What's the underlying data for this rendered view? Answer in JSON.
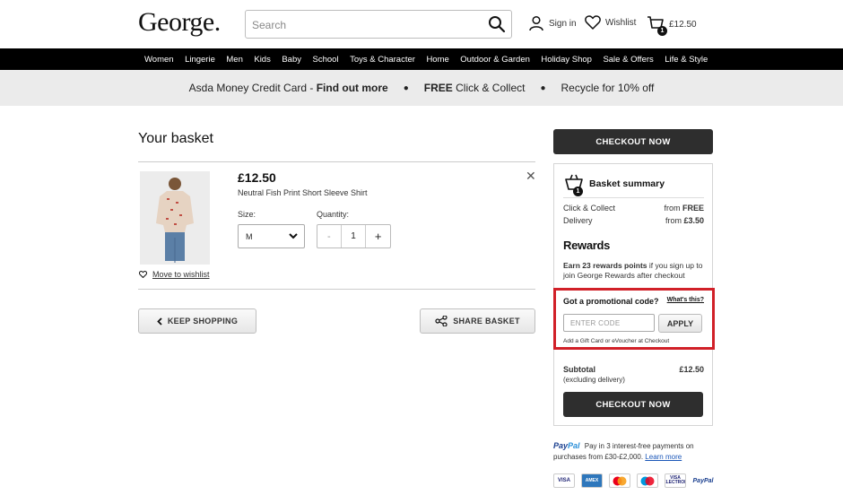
{
  "header": {
    "logo": "George.",
    "search_placeholder": "Search",
    "sign_in": "Sign in",
    "wishlist": "Wishlist",
    "bag_total": "£12.50",
    "bag_count": "1"
  },
  "nav": [
    "Women",
    "Lingerie",
    "Men",
    "Kids",
    "Baby",
    "School",
    "Toys & Character",
    "Home",
    "Outdoor & Garden",
    "Holiday Shop",
    "Sale & Offers",
    "Life & Style"
  ],
  "promo": {
    "item1_text": "Asda Money Credit Card - ",
    "item1_bold": "Find out more",
    "item2_bold": "FREE",
    "item2_text": " Click & Collect",
    "item3_text": "Recycle for 10% off"
  },
  "basket": {
    "title": "Your basket",
    "item": {
      "price": "£12.50",
      "name": "Neutral Fish Print Short Sleeve Shirt",
      "size_label": "Size:",
      "size_value": "M",
      "quantity_label": "Quantity:",
      "quantity": "1",
      "move_to_wishlist": "Move to wishlist"
    },
    "keep_shopping": "KEEP SHOPPING",
    "share_basket": "SHARE BASKET"
  },
  "summary": {
    "checkout_label": "CHECKOUT NOW",
    "title": "Basket summary",
    "count": "1",
    "click_collect_label": "Click & Collect",
    "click_collect_prefix": "from ",
    "click_collect_value": "FREE",
    "delivery_label": "Delivery",
    "delivery_prefix": "from ",
    "delivery_value": "£3.50",
    "rewards_title": "Rewards",
    "rewards_bold": "Earn 23 rewards points",
    "rewards_text": " if you sign up to join George Rewards after checkout",
    "promo_question": "Got a promotional code?",
    "whats_this": "What's this?",
    "code_placeholder": "ENTER CODE",
    "apply": "APPLY",
    "gift_note": "Add a Gift Card or eVoucher at Checkout",
    "subtotal_label": "Subtotal",
    "subtotal_note": "(excluding delivery)",
    "subtotal_value": "£12.50"
  },
  "paypal": {
    "brand_pay": "Pay",
    "brand_pal": "Pal",
    "text": "Pay in 3 interest-free payments on purchases from £30-£2,000.",
    "link": "Learn more"
  },
  "cards": [
    "VISA",
    "AMEX",
    "mastercard",
    "maestro",
    "VISA ELECTRON",
    "PayPal"
  ],
  "colors": {
    "accent": "#e07a16",
    "nav_bg": "#000000",
    "checkout_btn": "#2e2e2e",
    "highlight_border": "#d12028",
    "paypal_blue": "#1a3f8f"
  }
}
